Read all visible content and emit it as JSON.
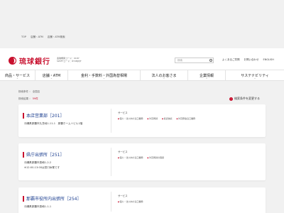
{
  "breadcrumb": [
    "TOP",
    "店舗・ATM",
    "店舗・ATM検索"
  ],
  "header": {
    "logo_text": "琉球銀行",
    "codes_line1": "金融機関コード：0187",
    "codes_line2": "SWIFTコード：RYUBJPJT",
    "search_placeholder": "検索",
    "links": [
      "よくあるご質問",
      "お問い合わせ",
      "ENGLISH"
    ]
  },
  "nav": [
    {
      "label": "商品・サービス",
      "w": 50
    },
    {
      "label": "店舗・ATM",
      "w": 46
    },
    {
      "label": "金利・手数料・外国為替相場",
      "w": 102
    },
    {
      "label": "法人のお客さま",
      "w": 67
    },
    {
      "label": "企業情報",
      "w": 53
    },
    {
      "label": "サステナビリティ",
      "w": 82
    }
  ],
  "results": {
    "condition": "検索条件 ： 全国店",
    "count_prefix": "検索結果 ： ",
    "count": "59件",
    "change_link": "検索条件を変更する"
  },
  "branches": [
    {
      "name": "本店営業部［201］",
      "address": "沖縄県那覇市久茂地1-11-1　那覇ホーム＋ビル1階",
      "hours": "",
      "service_label": "サービス",
      "services": [
        "個人・法人向け窓口業務",
        "外貨両替",
        "投資信託",
        "外貨預金窓口業務"
      ]
    },
    {
      "name": "県庁出張所［251］",
      "address": "沖縄県那覇市泉崎1-2-2",
      "hours": "※12:00-13:00は窓口休業です",
      "service_label": "サービス",
      "services": [
        "個人・法人向け窓口業務",
        "外貨両替の取扱"
      ]
    },
    {
      "name": "那覇市役所内出張所［254］",
      "address": "沖縄県那覇市泉崎1-1-1",
      "hours": "",
      "service_label": "サービス",
      "services": [
        "個人・法人向け窓口業務"
      ]
    }
  ]
}
